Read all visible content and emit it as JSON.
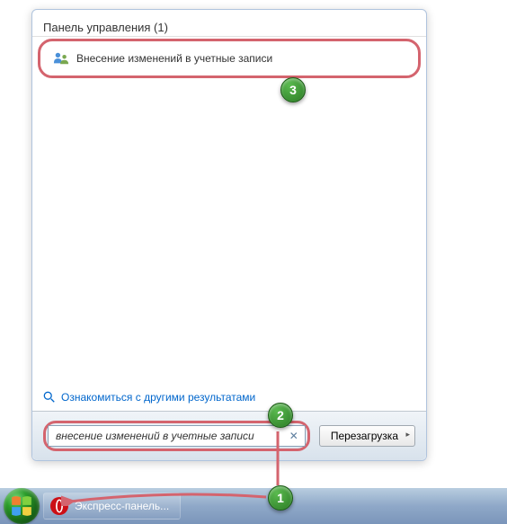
{
  "results": {
    "category_header": "Панель управления (1)",
    "item_label": "Внесение изменений в учетные записи",
    "more_results": "Ознакомиться с другими результатами"
  },
  "search": {
    "value": "внесение изменений в учетные записи"
  },
  "shutdown_label": "Перезагрузка",
  "taskbar": {
    "app_label": "Экспресс-панель..."
  },
  "annotations": {
    "a1": "1",
    "a2": "2",
    "a3": "3"
  }
}
